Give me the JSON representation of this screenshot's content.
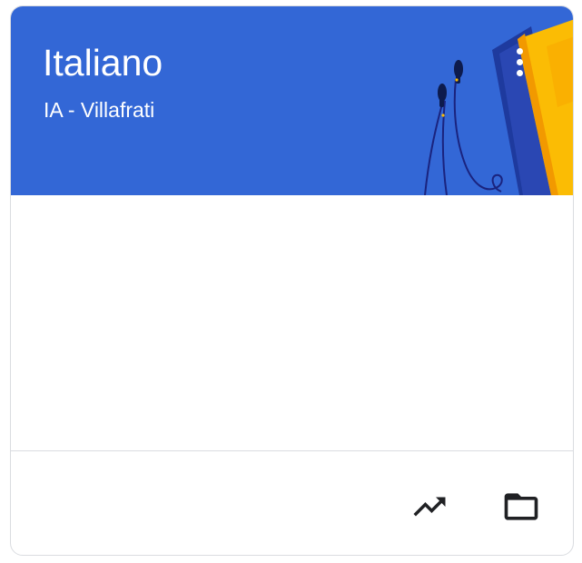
{
  "course": {
    "title": "Italiano",
    "section": "IA - Villafrati"
  },
  "header": {
    "background_color": "#3367d6",
    "illustration": "headphones-and-book"
  },
  "actions": {
    "more_icon": "more-vert-icon",
    "progress_icon": "trending-up-icon",
    "folder_icon": "folder-icon"
  }
}
